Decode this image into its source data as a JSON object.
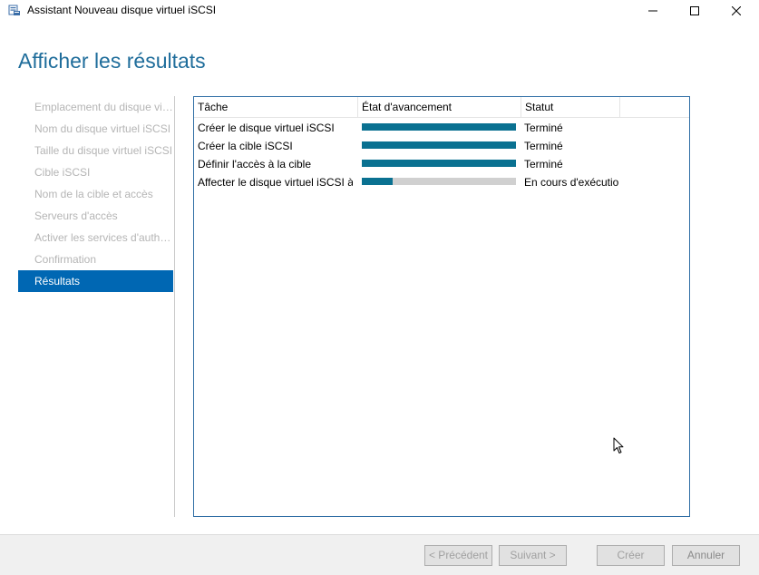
{
  "window": {
    "title": "Assistant Nouveau disque virtuel iSCSI",
    "icons": {
      "app": "iscsi-disk-icon",
      "minimize": "minimize-icon",
      "maximize": "maximize-icon",
      "close": "close-icon"
    }
  },
  "page": {
    "title": "Afficher les résultats"
  },
  "nav": {
    "items": [
      {
        "label": "Emplacement du disque virtuel iSCSI",
        "active": false
      },
      {
        "label": "Nom du disque virtuel iSCSI",
        "active": false
      },
      {
        "label": "Taille du disque virtuel iSCSI",
        "active": false
      },
      {
        "label": "Cible iSCSI",
        "active": false
      },
      {
        "label": "Nom de la cible et accès",
        "active": false
      },
      {
        "label": "Serveurs d'accès",
        "active": false
      },
      {
        "label": "Activer les services d'authentification",
        "active": false
      },
      {
        "label": "Confirmation",
        "active": false
      },
      {
        "label": "Résultats",
        "active": true
      }
    ]
  },
  "results": {
    "columns": {
      "task": "Tâche",
      "progress": "État d'avancement",
      "status": "Statut"
    },
    "rows": [
      {
        "task": "Créer le disque virtuel iSCSI",
        "progress": 1.0,
        "status": "Terminé"
      },
      {
        "task": "Créer la cible iSCSI",
        "progress": 1.0,
        "status": "Terminé"
      },
      {
        "task": "Définir l'accès à la cible",
        "progress": 1.0,
        "status": "Terminé"
      },
      {
        "task": "Affecter le disque virtuel iSCSI à",
        "progress": 0.2,
        "status": "En cours d'exécutio"
      }
    ]
  },
  "footer": {
    "previous": "< Précédent",
    "next": "Suivant >",
    "create": "Créer",
    "cancel": "Annuler"
  },
  "colors": {
    "accent": "#0067b3",
    "title": "#1f6d9b",
    "progress_fill": "#0a7191",
    "progress_track": "#d0d0d0",
    "nav_inactive": "#b5b5b5"
  }
}
